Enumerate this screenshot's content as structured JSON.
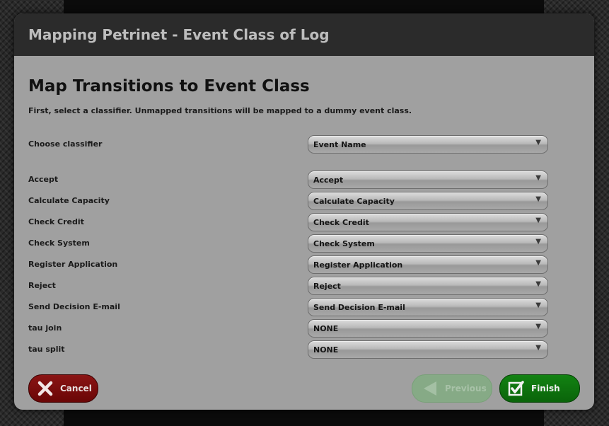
{
  "dialog": {
    "title": "Mapping Petrinet - Event Class of Log",
    "heading": "Map Transitions to Event Class",
    "instructions": "First, select a classifier. Unmapped transitions will be mapped to a dummy event class."
  },
  "classifier": {
    "label": "Choose classifier",
    "selected": "Event Name"
  },
  "mappings": [
    {
      "label": "Accept",
      "selected": "Accept"
    },
    {
      "label": "Calculate Capacity",
      "selected": "Calculate Capacity"
    },
    {
      "label": "Check Credit",
      "selected": "Check Credit"
    },
    {
      "label": "Check System",
      "selected": "Check System"
    },
    {
      "label": "Register Application",
      "selected": "Register Application"
    },
    {
      "label": "Reject",
      "selected": "Reject"
    },
    {
      "label": "Send Decision E-mail",
      "selected": "Send Decision E-mail"
    },
    {
      "label": "tau join",
      "selected": "NONE"
    },
    {
      "label": "tau split",
      "selected": "NONE"
    }
  ],
  "buttons": {
    "cancel": "Cancel",
    "previous": "Previous",
    "finish": "Finish"
  },
  "icons": {
    "cancel": "x-icon",
    "previous": "arrow-left-icon",
    "finish": "checkbox-checked-icon",
    "dropdown": "triangle-down-icon"
  },
  "colors": {
    "cancel_button": "#7a0c0c",
    "previous_button_disabled": "#86aa86",
    "finish_button": "#0e730e",
    "dialog_header": "#2b2b2b",
    "dialog_body": "#a0a0a0"
  }
}
